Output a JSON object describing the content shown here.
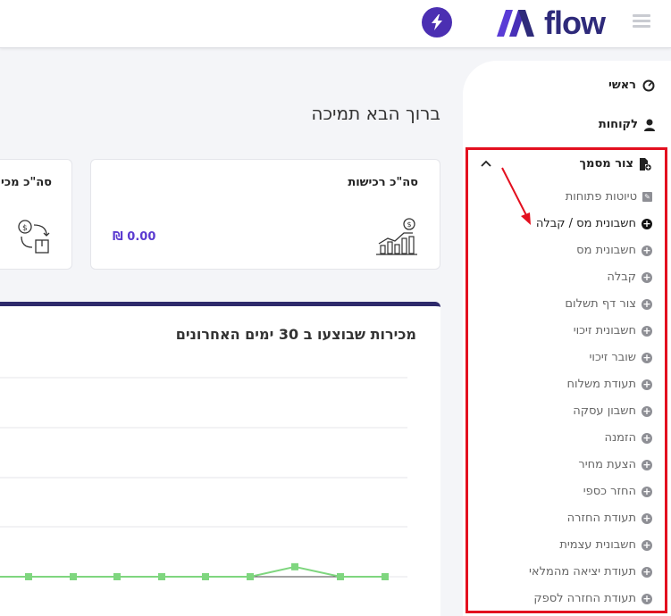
{
  "brand": {
    "logo_text": "flow"
  },
  "sidebar": {
    "home_label": "ראשי",
    "customers_label": "לקוחות",
    "create_doc_label": "צור מסמך",
    "submenu": [
      {
        "label": "טיוטות פתוחות",
        "icon": "pencil-icon"
      },
      {
        "label": "חשבונית מס / קבלה",
        "icon": "plus-circle-icon",
        "active": true
      },
      {
        "label": "חשבונית מס",
        "icon": "plus-circle-icon"
      },
      {
        "label": "קבלה",
        "icon": "plus-circle-icon"
      },
      {
        "label": "צור דף תשלום",
        "icon": "plus-circle-icon"
      },
      {
        "label": "חשבונית זיכוי",
        "icon": "plus-circle-icon"
      },
      {
        "label": "שובר זיכוי",
        "icon": "plus-circle-icon"
      },
      {
        "label": "תעודת משלוח",
        "icon": "plus-circle-icon"
      },
      {
        "label": "חשבון עסקה",
        "icon": "plus-circle-icon"
      },
      {
        "label": "הזמנה",
        "icon": "plus-circle-icon"
      },
      {
        "label": "הצעת מחיר",
        "icon": "plus-circle-icon"
      },
      {
        "label": "החזר כספי",
        "icon": "plus-circle-icon"
      },
      {
        "label": "תעודת החזרה",
        "icon": "plus-circle-icon"
      },
      {
        "label": "חשבונית עצמית",
        "icon": "plus-circle-icon"
      },
      {
        "label": "תעודת יציאה מהמלאי",
        "icon": "plus-circle-icon"
      },
      {
        "label": "תעודת החזרה לספק",
        "icon": "plus-circle-icon"
      }
    ]
  },
  "main": {
    "welcome": "ברוך הבא תמיכה",
    "cards": [
      {
        "title": "סה\"כ רכישות",
        "value": "0.00 ₪",
        "icon": "growth-chart-icon"
      },
      {
        "title": "סה\"כ מכי",
        "icon": "money-exchange-icon"
      }
    ],
    "chart_title": "מכירות שבוצעו ב 30 ימים האחרונים"
  },
  "colors": {
    "accent": "#5b3bd0",
    "brand_dark": "#2e2a7a",
    "highlight": "#e3101f",
    "series": "#7fd67f"
  },
  "chart_data": {
    "type": "line",
    "title": "מכירות שבוצעו ב 30 ימים האחרונים",
    "grid": true,
    "x": [
      1,
      2,
      3,
      4,
      5,
      6,
      7,
      8,
      9
    ],
    "series": [
      {
        "values": [
          0,
          0,
          0,
          0,
          0,
          0,
          1,
          0,
          0
        ]
      }
    ],
    "ylim": [
      0,
      20
    ]
  }
}
